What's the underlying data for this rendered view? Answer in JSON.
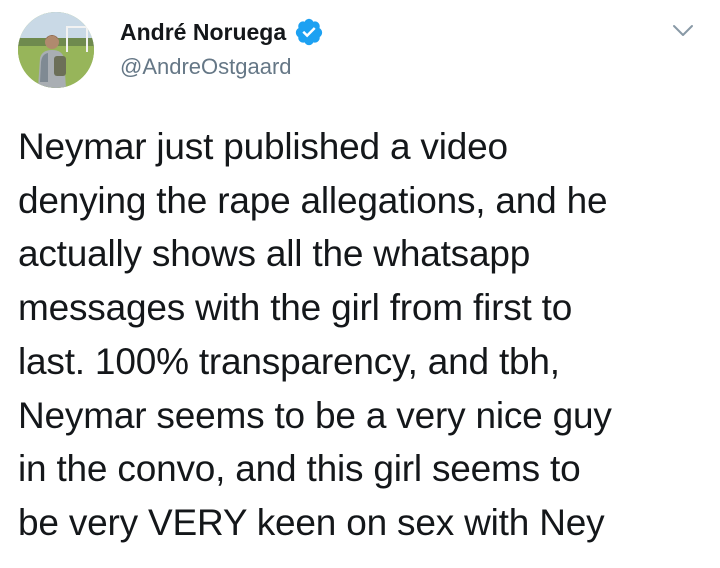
{
  "author": {
    "display_name": "André Noruega",
    "handle": "@AndreOstgaard",
    "verified": true,
    "avatar_icon": "profile-photo"
  },
  "menu": {
    "icon": "chevron-down-icon"
  },
  "tweet": {
    "text": "Neymar just published a video\ndenying the rape allegations, and he\nactually shows all the whatsapp\nmessages with the girl from first to\nlast. 100% transparency, and tbh,\nNeymar seems to be a very nice guy\nin the convo, and this girl seems to\nbe very VERY keen on sex with Ney"
  },
  "colors": {
    "verified_blue": "#1da1f2",
    "handle_gray": "#657786",
    "text": "#14171a",
    "chevron_gray": "#8899a6"
  }
}
